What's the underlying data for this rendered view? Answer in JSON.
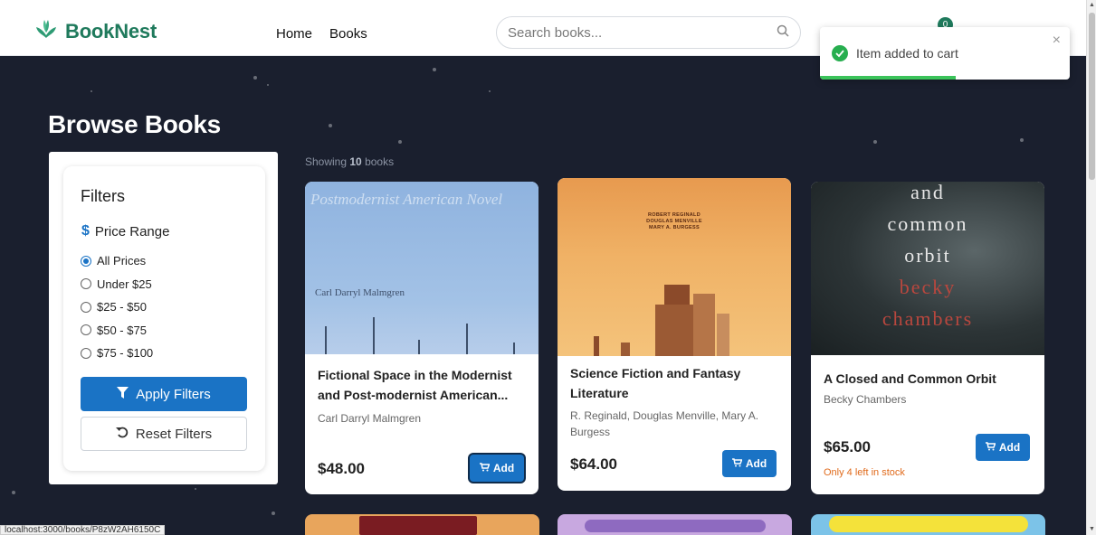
{
  "header": {
    "brand": "BookNest",
    "nav": [
      "Home",
      "Books"
    ],
    "search_placeholder": "Search books...",
    "cart_count": "0"
  },
  "toast": {
    "message": "Item added to cart",
    "close": "×"
  },
  "page": {
    "title": "Browse Books",
    "showing_prefix": "Showing",
    "showing_count": "10",
    "showing_suffix": "books"
  },
  "filters": {
    "title": "Filters",
    "price_label": "Price Range",
    "price_icon": "$",
    "options": [
      "All Prices",
      "Under $25",
      "$25 - $50",
      "$50 - $75",
      "$75 - $100"
    ],
    "selected": "All Prices",
    "apply_label": "Apply Filters",
    "reset_label": "Reset Filters"
  },
  "books": [
    {
      "title_line1": "Fictional Space in the Modernist",
      "title_line2": "and Post-modernist American...",
      "author": "Carl Darryl Malmgren",
      "price": "$48.00",
      "add_label": "Add",
      "cover_text_top": "Postmodernist American Novel",
      "cover_text_author": "Carl Darryl Malmgren"
    },
    {
      "title_line1": "Science Fiction and Fantasy",
      "title_line2": "Literature",
      "author_line1": "R. Reginald, Douglas Menville, Mary A.",
      "author_line2": "Burgess",
      "price": "$64.00",
      "add_label": "Add",
      "cover_text": [
        "ROBERT REGINALD",
        "DOUGLAS MENVILLE",
        "MARY A. BURGESS"
      ]
    },
    {
      "title": "A Closed and Common Orbit",
      "author": "Becky Chambers",
      "price": "$65.00",
      "add_label": "Add",
      "stock": "Only 4 left in stock",
      "cover_text": [
        "and",
        "common",
        "orbit",
        "becky",
        "chambers"
      ]
    }
  ],
  "status_url": "localhost:3000/books/P8zW2AH6150C",
  "colors": {
    "brand": "#1f7a5c",
    "primary": "#1a73c5",
    "background": "#1a1f2e",
    "success": "#27ae4f",
    "warning": "#e06a1b"
  }
}
